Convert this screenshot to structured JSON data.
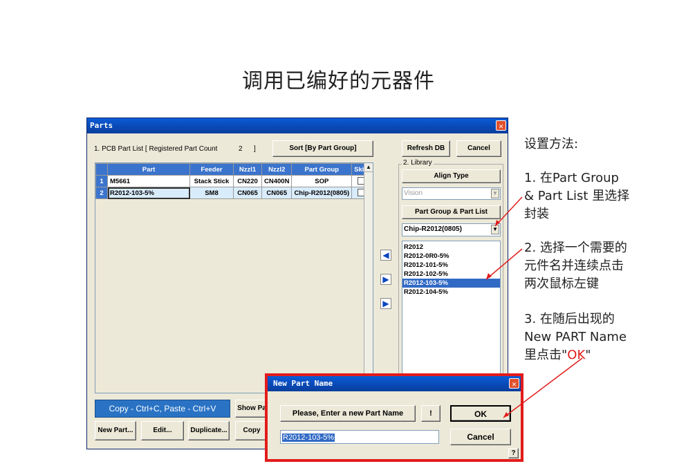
{
  "slide_title": "调用已编好的元器件",
  "parts_window": {
    "title": "Parts",
    "pcb_part_list_label": "1. PCB Part List  [ Registered Part Count",
    "part_count": "2",
    "count_close": "]",
    "sort_button": "Sort [By Part Group]",
    "refresh_db_button": "Refresh DB",
    "cancel_button": "Cancel",
    "grid": {
      "columns": [
        "Part",
        "Feeder",
        "Nzzl1",
        "Nzzl2",
        "Part Group",
        "Skip"
      ],
      "rows": [
        {
          "num": "1",
          "part": "M5661",
          "feeder": "Stack Stick",
          "nzzl1": "CN220",
          "nzzl2": "CN400N",
          "group": "SOP"
        },
        {
          "num": "2",
          "part": "R2012-103-5%",
          "feeder": "SM8",
          "nzzl1": "CN065",
          "nzzl2": "CN065",
          "group": "Chip-R2012(0805)"
        }
      ]
    },
    "copy_paste_label": "Copy - Ctrl+C, Paste - Ctrl+V",
    "show_button": "Show Pa",
    "new_part_button": "New Part...",
    "edit_button": "Edit...",
    "duplicate_button": "Duplicate...",
    "copy_button": "Copy",
    "library": {
      "label": "2. Library",
      "align_type_label": "Align Type",
      "align_type_value": "Vision",
      "part_group_list_label": "Part Group & Part List",
      "group_value": "Chip-R2012(0805)",
      "items": [
        "R2012",
        "R2012-0R0-5%",
        "R2012-101-5%",
        "R2012-102-5%",
        "R2012-103-5%",
        "R2012-104-5%"
      ],
      "selected_index": 4
    }
  },
  "dialog": {
    "title": "New Part Name",
    "prompt": "Please, Enter a new Part Name",
    "bang_button": "!",
    "ok_button": "OK",
    "cancel_button": "Cancel",
    "input_value": "R2012-103-5%",
    "help_button": "?"
  },
  "annotations": {
    "heading": "设置方法:",
    "step1_a": "1.  在Part  Group",
    "step1_b": "&  Part  List 里选择",
    "step1_c": "封装",
    "step2_a": "2. 选择一个需要的",
    "step2_b": "元件名并连续点击",
    "step2_c": "两次鼠标左键",
    "step3_a": "3. 在随后出现的",
    "step3_b": "New  PART  Name",
    "step3_c": "里点击\"",
    "step3_ok": "OK",
    "step3_end": "\""
  },
  "colors": {
    "highlight_red": "#e21b1b",
    "titlebar_blue": "#0948b4",
    "selection_blue": "#316ac5"
  }
}
